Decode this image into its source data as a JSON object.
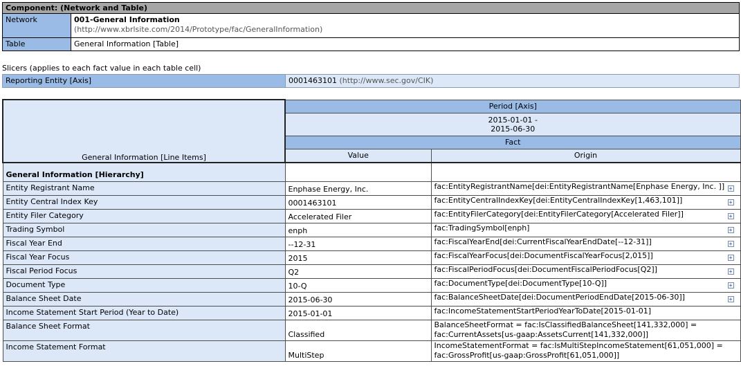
{
  "component": {
    "header": "Component: (Network and Table)",
    "network_label": "Network",
    "network_name": "001-General Information",
    "network_uri": "(http://www.xbrlsite.com/2014/Prototype/fac/GeneralInformation)",
    "table_label": "Table",
    "table_name": "General Information [Table]"
  },
  "slicers": {
    "caption": "Slicers (applies to each fact value in each table cell)",
    "axis": "Reporting Entity [Axis]",
    "value": "0001463101",
    "value_uri": "(http://www.sec.gov/CIK)"
  },
  "grid": {
    "corner_label": "General Information [Line Items]",
    "period_axis": "Period [Axis]",
    "period_line1": "2015-01-01 -",
    "period_line2": "2015-06-30",
    "fact": "Fact",
    "value_col": "Value",
    "origin_col": "Origin",
    "hierarchy": "General Information [Hierarchy]",
    "rows": [
      {
        "label": "Entity Registrant Name",
        "value": "Enphase Energy, Inc.",
        "origin": "fac:EntityRegistrantName[dei:EntityRegistrantName[Enphase Energy, Inc. ]]",
        "expand": true
      },
      {
        "label": "Entity Central Index Key",
        "value": "0001463101",
        "origin": "fac:EntityCentralIndexKey[dei:EntityCentralIndexKey[1,463,101]]",
        "expand": true
      },
      {
        "label": "Entity Filer Category",
        "value": "Accelerated Filer",
        "origin": "fac:EntityFilerCategory[dei:EntityFilerCategory[Accelerated Filer]]",
        "expand": true
      },
      {
        "label": "Trading Symbol",
        "value": "enph",
        "origin": "fac:TradingSymbol[enph]",
        "expand": true
      },
      {
        "label": "Fiscal Year End",
        "value": "--12-31",
        "origin": "fac:FiscalYearEnd[dei:CurrentFiscalYearEndDate[--12-31]]",
        "expand": true
      },
      {
        "label": "Fiscal Year Focus",
        "value": "2015",
        "origin": "fac:FiscalYearFocus[dei:DocumentFiscalYearFocus[2,015]]",
        "expand": true
      },
      {
        "label": "Fiscal Period Focus",
        "value": "Q2",
        "origin": "fac:FiscalPeriodFocus[dei:DocumentFiscalPeriodFocus[Q2]]",
        "expand": true
      },
      {
        "label": "Document Type",
        "value": "10-Q",
        "origin": "fac:DocumentType[dei:DocumentType[10-Q]]",
        "expand": true
      },
      {
        "label": "Balance Sheet Date",
        "value": "2015-06-30",
        "origin": "fac:BalanceSheetDate[dei:DocumentPeriodEndDate[2015-06-30]]",
        "expand": true
      },
      {
        "label": "Income Statement Start Period (Year to Date)",
        "value": "2015-01-01",
        "origin": "fac:IncomeStatementStartPeriodYearToDate[2015-01-01]",
        "expand": false
      }
    ],
    "rows2": [
      {
        "label": "Balance Sheet Format",
        "value": "Classified",
        "origin1": "BalanceSheetFormat = fac:IsClassifiedBalanceSheet[141,332,000] =",
        "origin2": "fac:CurrentAssets[us-gaap:AssetsCurrent[141,332,000]]"
      },
      {
        "label": "Income Statement Format",
        "value": "MultiStep",
        "origin1": "IncomeStatementFormat = fac:IsMultiStepIncomeStatement[61,051,000] =",
        "origin2": "fac:GrossProfit[us-gaap:GrossProfit[61,051,000]]"
      }
    ],
    "expand_icon": "plus-box-icon"
  }
}
